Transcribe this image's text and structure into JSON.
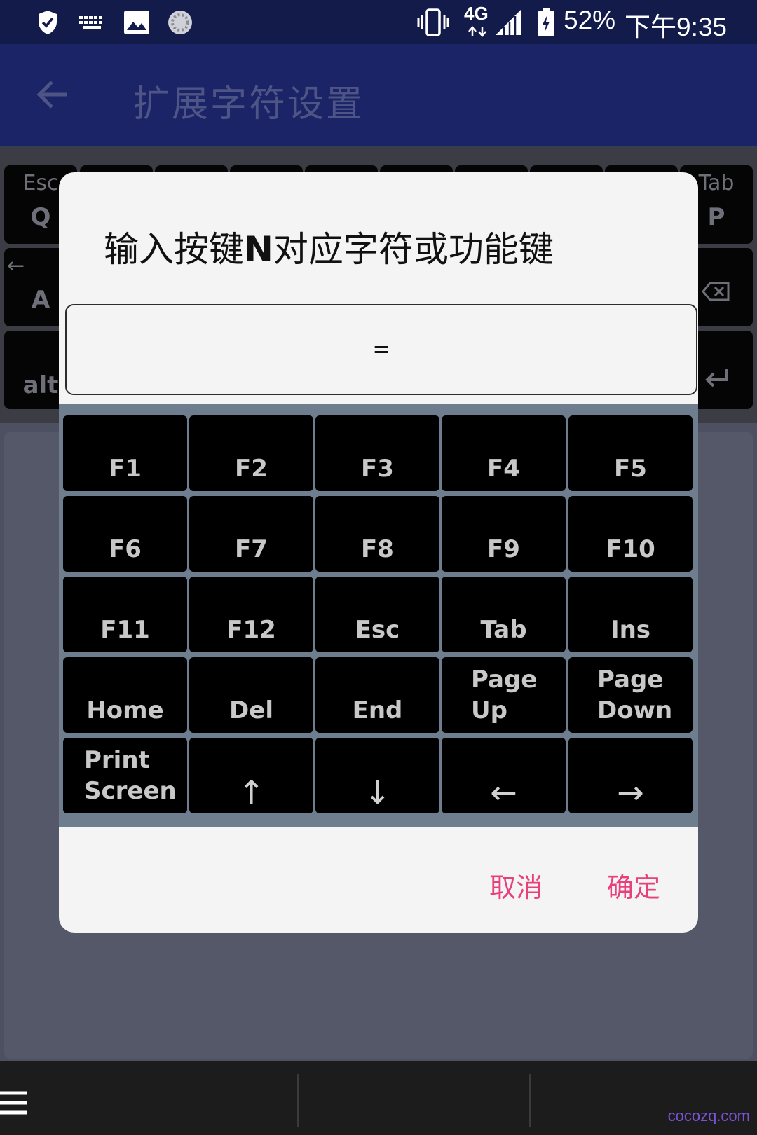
{
  "status_bar": {
    "battery_percent": "52%",
    "time": "下午9:35",
    "network": "4G",
    "icons": [
      "shield-icon",
      "keyboard-icon",
      "image-icon",
      "sync-icon",
      "vibrate-icon",
      "signal-icon",
      "battery-icon"
    ]
  },
  "app_bar": {
    "title": "扩展字符设置",
    "back_icon": "arrow-left-icon"
  },
  "background_keyboard": {
    "row1": {
      "left_top": "Esc",
      "left_main": "Q",
      "right_top": "Tab",
      "right_main": "P"
    },
    "row2": {
      "left_top": "←",
      "left_main": "A",
      "right_icon": "backspace-icon"
    },
    "row3": {
      "left_main": "alt",
      "right_icon": "enter-icon"
    }
  },
  "dialog": {
    "title_prefix": "输入按键",
    "title_key": "N",
    "title_suffix": "对应字符或功能键",
    "input_value": "=",
    "keys": [
      [
        "F1",
        "F2",
        "F3",
        "F4",
        "F5"
      ],
      [
        "F6",
        "F7",
        "F8",
        "F9",
        "F10"
      ],
      [
        "F11",
        "F12",
        "Esc",
        "Tab",
        "Ins"
      ],
      [
        "Home",
        "Del",
        "End",
        "Page\nUp",
        "Page\nDown"
      ],
      [
        "Print\nScreen",
        "↑",
        "↓",
        "←",
        "→"
      ]
    ],
    "cancel_label": "取消",
    "confirm_label": "确定"
  },
  "watermark": "cocozq.com",
  "colors": {
    "status_bar": "#121b4a",
    "app_bar": "#1a2466",
    "dialog_bg": "#f4f4f4",
    "key_bg": "#000000",
    "key_grid_bg": "#6e7e8e",
    "button_accent": "#e8407a"
  }
}
